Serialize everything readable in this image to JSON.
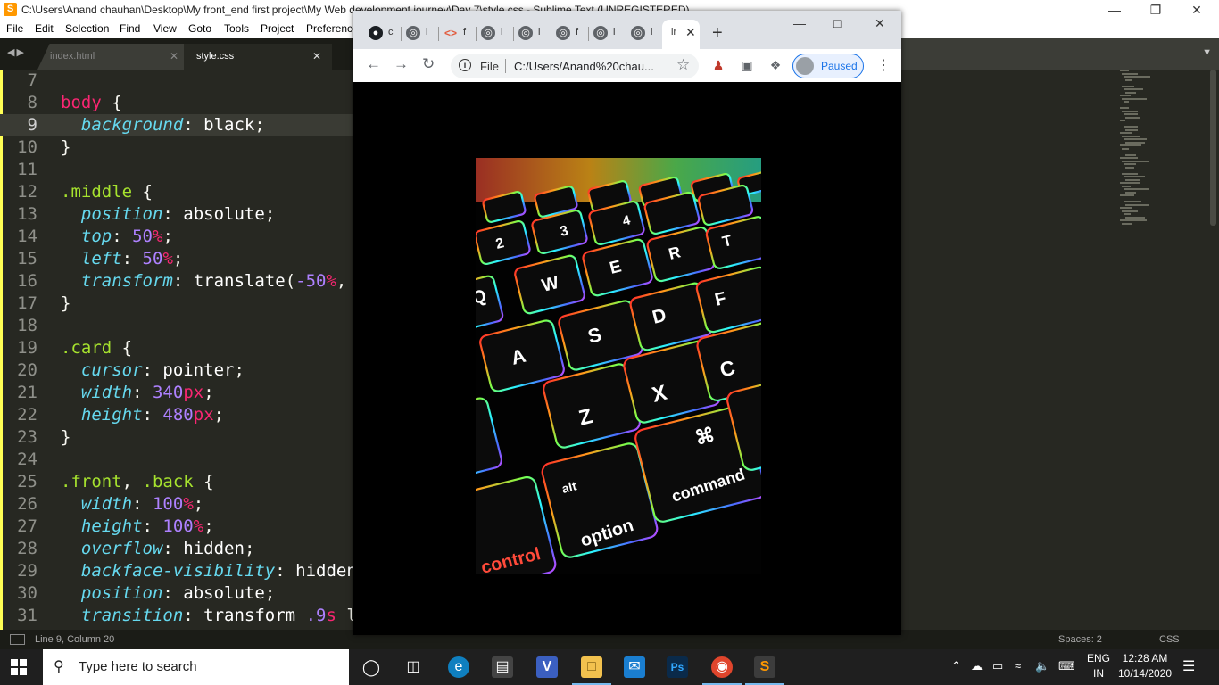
{
  "sublime": {
    "title": "C:\\Users\\Anand chauhan\\Desktop\\My front_end first project\\My Web development journey\\Day 7\\style.css - Sublime Text (UNREGISTERED)",
    "menu": [
      "File",
      "Edit",
      "Selection",
      "Find",
      "View",
      "Goto",
      "Tools",
      "Project",
      "Preferences"
    ],
    "tabs": [
      {
        "label": "index.html",
        "active": false
      },
      {
        "label": "style.css",
        "active": true
      }
    ],
    "code_lines": [
      {
        "n": "7",
        "parts": []
      },
      {
        "n": "8",
        "parts": [
          [
            "tag",
            "body"
          ],
          [
            "pun",
            " {"
          ]
        ]
      },
      {
        "n": "9",
        "parts": [
          [
            "pun",
            "  "
          ],
          [
            "prop",
            "background"
          ],
          [
            "pun",
            ": "
          ],
          [
            "val",
            "black"
          ],
          [
            "pun",
            ";"
          ]
        ]
      },
      {
        "n": "10",
        "parts": [
          [
            "pun",
            "}"
          ]
        ]
      },
      {
        "n": "11",
        "parts": []
      },
      {
        "n": "12",
        "parts": [
          [
            "cls",
            ".middle"
          ],
          [
            "pun",
            " {"
          ]
        ]
      },
      {
        "n": "13",
        "parts": [
          [
            "pun",
            "  "
          ],
          [
            "prop",
            "position"
          ],
          [
            "pun",
            ": "
          ],
          [
            "val",
            "absolute"
          ],
          [
            "pun",
            ";"
          ]
        ]
      },
      {
        "n": "14",
        "parts": [
          [
            "pun",
            "  "
          ],
          [
            "prop",
            "top"
          ],
          [
            "pun",
            ": "
          ],
          [
            "num",
            "50"
          ],
          [
            "unit",
            "%"
          ],
          [
            "pun",
            ";"
          ]
        ]
      },
      {
        "n": "15",
        "parts": [
          [
            "pun",
            "  "
          ],
          [
            "prop",
            "left"
          ],
          [
            "pun",
            ": "
          ],
          [
            "num",
            "50"
          ],
          [
            "unit",
            "%"
          ],
          [
            "pun",
            ";"
          ]
        ]
      },
      {
        "n": "16",
        "parts": [
          [
            "pun",
            "  "
          ],
          [
            "prop",
            "transform"
          ],
          [
            "pun",
            ": "
          ],
          [
            "val",
            "translate"
          ],
          [
            "pun",
            "("
          ],
          [
            "num",
            "-50"
          ],
          [
            "unit",
            "%"
          ],
          [
            "pun",
            ","
          ]
        ]
      },
      {
        "n": "17",
        "parts": [
          [
            "pun",
            "}"
          ]
        ]
      },
      {
        "n": "18",
        "parts": []
      },
      {
        "n": "19",
        "parts": [
          [
            "cls",
            ".card"
          ],
          [
            "pun",
            " {"
          ]
        ]
      },
      {
        "n": "20",
        "parts": [
          [
            "pun",
            "  "
          ],
          [
            "prop",
            "cursor"
          ],
          [
            "pun",
            ": "
          ],
          [
            "val",
            "pointer"
          ],
          [
            "pun",
            ";"
          ]
        ]
      },
      {
        "n": "21",
        "parts": [
          [
            "pun",
            "  "
          ],
          [
            "prop",
            "width"
          ],
          [
            "pun",
            ": "
          ],
          [
            "num",
            "340"
          ],
          [
            "unit",
            "px"
          ],
          [
            "pun",
            ";"
          ]
        ]
      },
      {
        "n": "22",
        "parts": [
          [
            "pun",
            "  "
          ],
          [
            "prop",
            "height"
          ],
          [
            "pun",
            ": "
          ],
          [
            "num",
            "480"
          ],
          [
            "unit",
            "px"
          ],
          [
            "pun",
            ";"
          ]
        ]
      },
      {
        "n": "23",
        "parts": [
          [
            "pun",
            "}"
          ]
        ]
      },
      {
        "n": "24",
        "parts": []
      },
      {
        "n": "25",
        "parts": [
          [
            "cls",
            ".front"
          ],
          [
            "pun",
            ", "
          ],
          [
            "cls",
            ".back"
          ],
          [
            "pun",
            " {"
          ]
        ]
      },
      {
        "n": "26",
        "parts": [
          [
            "pun",
            "  "
          ],
          [
            "prop",
            "width"
          ],
          [
            "pun",
            ": "
          ],
          [
            "num",
            "100"
          ],
          [
            "unit",
            "%"
          ],
          [
            "pun",
            ";"
          ]
        ]
      },
      {
        "n": "27",
        "parts": [
          [
            "pun",
            "  "
          ],
          [
            "prop",
            "height"
          ],
          [
            "pun",
            ": "
          ],
          [
            "num",
            "100"
          ],
          [
            "unit",
            "%"
          ],
          [
            "pun",
            ";"
          ]
        ]
      },
      {
        "n": "28",
        "parts": [
          [
            "pun",
            "  "
          ],
          [
            "prop",
            "overflow"
          ],
          [
            "pun",
            ": "
          ],
          [
            "val",
            "hidden"
          ],
          [
            "pun",
            ";"
          ]
        ]
      },
      {
        "n": "29",
        "parts": [
          [
            "pun",
            "  "
          ],
          [
            "prop",
            "backface-visibility"
          ],
          [
            "pun",
            ": "
          ],
          [
            "val",
            "hidden"
          ]
        ]
      },
      {
        "n": "30",
        "parts": [
          [
            "pun",
            "  "
          ],
          [
            "prop",
            "position"
          ],
          [
            "pun",
            ": "
          ],
          [
            "val",
            "absolute"
          ],
          [
            "pun",
            ";"
          ]
        ]
      },
      {
        "n": "31",
        "parts": [
          [
            "pun",
            "  "
          ],
          [
            "prop",
            "transition"
          ],
          [
            "pun",
            ": "
          ],
          [
            "val",
            "transform"
          ],
          [
            "pun",
            " "
          ],
          [
            "num",
            ".9"
          ],
          [
            "unit",
            "s"
          ],
          [
            "pun",
            " l"
          ]
        ]
      }
    ],
    "active_line": "9",
    "status_left": "Line 9, Column 20",
    "status_spaces": "Spaces: 2",
    "status_syntax": "CSS"
  },
  "chrome": {
    "tabs": [
      {
        "icon": "github-icon",
        "text": "c"
      },
      {
        "icon": "globe-icon",
        "text": "i"
      },
      {
        "icon": "code-icon",
        "text": "f"
      },
      {
        "icon": "globe-icon",
        "text": "i"
      },
      {
        "icon": "globe-icon",
        "text": "i"
      },
      {
        "icon": "globe-icon",
        "text": "f"
      },
      {
        "icon": "globe-icon",
        "text": "i"
      },
      {
        "icon": "globe-icon",
        "text": "i"
      }
    ],
    "active_tab_text": "ir",
    "address_scheme": "File",
    "address_url": "C:/Users/Anand%20chau...",
    "profile_label": "Paused",
    "card_keys": {
      "row_num": [
        "2",
        "3",
        "4"
      ],
      "row_q": [
        "Q",
        "W",
        "E",
        "R",
        "T"
      ],
      "row_a": [
        "A",
        "S",
        "D",
        "F"
      ],
      "row_z": [
        "Z",
        "X",
        "C"
      ],
      "alt_top": "alt",
      "alt_bottom": "option",
      "cmd_symbol": "⌘",
      "cmd_label": "command",
      "control": "control"
    }
  },
  "taskbar": {
    "search_placeholder": "Type here to search",
    "lang_top": "ENG",
    "lang_bottom": "IN",
    "time": "12:28 AM",
    "date": "10/14/2020"
  }
}
